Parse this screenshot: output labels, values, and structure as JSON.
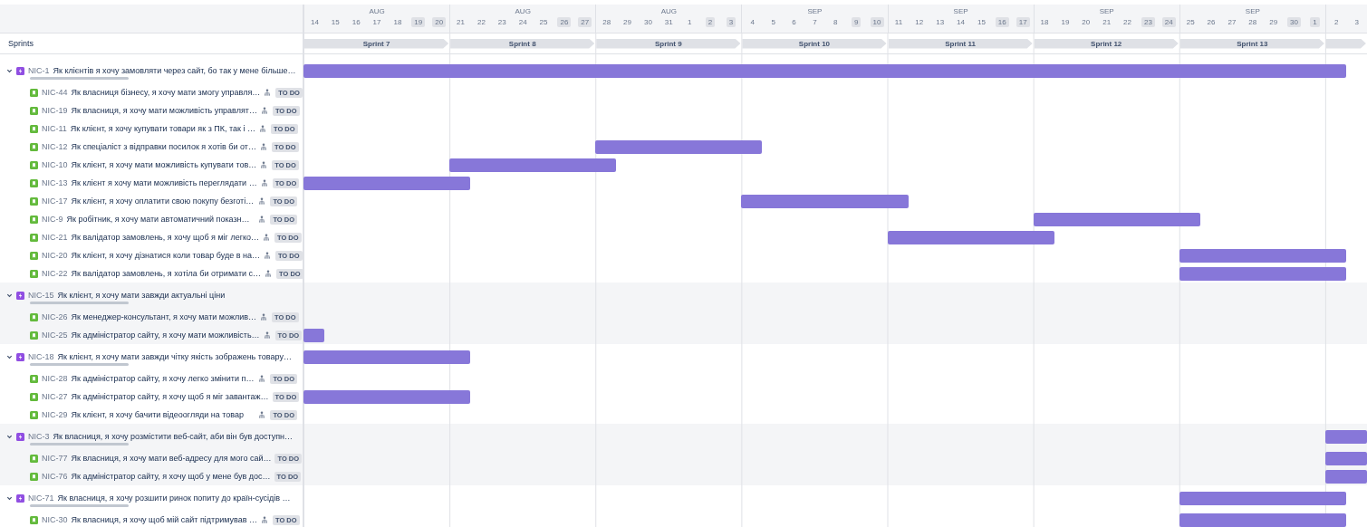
{
  "header": {
    "sprints_label": "Sprints"
  },
  "weeks": [
    {
      "month": "AUG",
      "days": [
        {
          "label": "14",
          "weekend": false
        },
        {
          "label": "15",
          "weekend": false
        },
        {
          "label": "16",
          "weekend": false
        },
        {
          "label": "17",
          "weekend": false
        },
        {
          "label": "18",
          "weekend": false
        },
        {
          "label": "19",
          "weekend": true
        },
        {
          "label": "20",
          "weekend": true
        }
      ]
    },
    {
      "month": "AUG",
      "days": [
        {
          "label": "21",
          "weekend": false
        },
        {
          "label": "22",
          "weekend": false
        },
        {
          "label": "23",
          "weekend": false
        },
        {
          "label": "24",
          "weekend": false
        },
        {
          "label": "25",
          "weekend": false
        },
        {
          "label": "26",
          "weekend": true
        },
        {
          "label": "27",
          "weekend": true
        }
      ]
    },
    {
      "month": "AUG",
      "days": [
        {
          "label": "28",
          "weekend": false
        },
        {
          "label": "29",
          "weekend": false
        },
        {
          "label": "30",
          "weekend": false
        },
        {
          "label": "31",
          "weekend": false
        },
        {
          "label": "1",
          "weekend": false
        },
        {
          "label": "2",
          "weekend": true
        },
        {
          "label": "3",
          "weekend": true
        }
      ]
    },
    {
      "month": "SEP",
      "days": [
        {
          "label": "4",
          "weekend": false
        },
        {
          "label": "5",
          "weekend": false
        },
        {
          "label": "6",
          "weekend": false
        },
        {
          "label": "7",
          "weekend": false
        },
        {
          "label": "8",
          "weekend": false
        },
        {
          "label": "9",
          "weekend": true
        },
        {
          "label": "10",
          "weekend": true
        }
      ]
    },
    {
      "month": "SEP",
      "days": [
        {
          "label": "11",
          "weekend": false
        },
        {
          "label": "12",
          "weekend": false
        },
        {
          "label": "13",
          "weekend": false
        },
        {
          "label": "14",
          "weekend": false
        },
        {
          "label": "15",
          "weekend": false
        },
        {
          "label": "16",
          "weekend": true
        },
        {
          "label": "17",
          "weekend": true
        }
      ]
    },
    {
      "month": "SEP",
      "days": [
        {
          "label": "18",
          "weekend": false
        },
        {
          "label": "19",
          "weekend": false
        },
        {
          "label": "20",
          "weekend": false
        },
        {
          "label": "21",
          "weekend": false
        },
        {
          "label": "22",
          "weekend": false
        },
        {
          "label": "23",
          "weekend": true
        },
        {
          "label": "24",
          "weekend": true
        }
      ]
    },
    {
      "month": "SEP",
      "days": [
        {
          "label": "25",
          "weekend": false
        },
        {
          "label": "26",
          "weekend": false
        },
        {
          "label": "27",
          "weekend": false
        },
        {
          "label": "28",
          "weekend": false
        },
        {
          "label": "29",
          "weekend": false
        },
        {
          "label": "30",
          "weekend": true
        },
        {
          "label": "1",
          "weekend": true
        }
      ]
    },
    {
      "days": [
        {
          "label": "2",
          "weekend": false
        },
        {
          "label": "3",
          "weekend": false
        }
      ]
    }
  ],
  "sprints": [
    {
      "label": "Sprint 7"
    },
    {
      "label": "Sprint 8"
    },
    {
      "label": "Sprint 9"
    },
    {
      "label": "Sprint 10"
    },
    {
      "label": "Sprint 11"
    },
    {
      "label": "Sprint 12"
    },
    {
      "label": "Sprint 13"
    }
  ],
  "epics": [
    {
      "key": "NIC-1",
      "summary": "Як клієнтів я хочу замовляти через сайт, бо так у мене більше…",
      "expanded": true,
      "children": [
        {
          "key": "NIC-44",
          "summary": "Як власниця бізнесу, я хочу мати змогу управля…",
          "assignee_icon": true,
          "status": "TO DO"
        },
        {
          "key": "NIC-19",
          "summary": "Як власниця, я хочу мати можливість управлят…",
          "assignee_icon": true,
          "status": "TO DO"
        },
        {
          "key": "NIC-11",
          "summary": "Як клієнт, я хочу купувати товари як з ПК, так і …",
          "assignee_icon": true,
          "status": "TO DO"
        },
        {
          "key": "NIC-12",
          "summary": "Як спеціаліст з відправки посилок я хотів би от…",
          "assignee_icon": true,
          "status": "TO DO"
        },
        {
          "key": "NIC-10",
          "summary": "Як клієнт, я хочу мати можливість купувати тов…",
          "assignee_icon": true,
          "status": "TO DO"
        },
        {
          "key": "NIC-13",
          "summary": "Як клієнт я хочу мати можливість переглядати …",
          "assignee_icon": true,
          "status": "TO DO"
        },
        {
          "key": "NIC-17",
          "summary": "Як клієнт, я хочу оплатити свою покупу безготі…",
          "assignee_icon": true,
          "status": "TO DO"
        },
        {
          "key": "NIC-9",
          "summary": "Як робітник, я хочу мати автоматичний показн…",
          "assignee_icon": true,
          "status": "TO DO"
        },
        {
          "key": "NIC-21",
          "summary": "Як валідатор замовлень, я хочу щоб я міг легко…",
          "assignee_icon": true,
          "status": "TO DO"
        },
        {
          "key": "NIC-20",
          "summary": "Як клієнт, я хочу дізнатися коли товар буде в на…",
          "assignee_icon": true,
          "status": "TO DO"
        },
        {
          "key": "NIC-22",
          "summary": "Як валідатор замовлень, я хотіла би отримати с…",
          "assignee_icon": true,
          "status": "TO DO"
        }
      ]
    },
    {
      "key": "NIC-15",
      "summary": "Як клієнт, я хочу мати завжди актуальні ціни",
      "expanded": true,
      "children": [
        {
          "key": "NIC-26",
          "summary": "Як менеджер-консультант, я хочу мати можлив…",
          "assignee_icon": true,
          "status": "TO DO"
        },
        {
          "key": "NIC-25",
          "summary": "Як адміністратор сайту, я хочу мати можливість…",
          "assignee_icon": true,
          "status": "TO DO"
        }
      ]
    },
    {
      "key": "NIC-18",
      "summary": "Як клієнт, я хочу мати завжди чітку якість зображень товару…",
      "expanded": true,
      "children": [
        {
          "key": "NIC-28",
          "summary": "Як адміністратор сайту, я хочу легко змінити п…",
          "assignee_icon": true,
          "status": "TO DO"
        },
        {
          "key": "NIC-27",
          "summary": "Як адміністратор сайту, я хочу щоб я міг завантаж…",
          "assignee_icon": false,
          "status": "TO DO"
        },
        {
          "key": "NIC-29",
          "summary": "Як клієнт, я хочу бачити відеоогляди на товар",
          "assignee_icon": true,
          "status": "TO DO"
        }
      ]
    },
    {
      "key": "NIC-3",
      "summary": "Як власниця, я хочу розмістити веб-сайт, аби він був доступн…",
      "expanded": true,
      "children": [
        {
          "key": "NIC-77",
          "summary": "Як власниця, я хочу мати веб-адресу для мого сай…",
          "assignee_icon": false,
          "status": "TO DO"
        },
        {
          "key": "NIC-76",
          "summary": "Як адміністратор сайту, я хочу щоб у мене був дос…",
          "assignee_icon": false,
          "status": "TO DO"
        }
      ]
    },
    {
      "key": "NIC-71",
      "summary": "Як власниця, я хочу розшити ринок попиту до країн-сусідів …",
      "expanded": true,
      "children": [
        {
          "key": "NIC-30",
          "summary": "Як власниця, я хочу щоб мій сайт підтримував …",
          "assignee_icon": true,
          "status": "TO DO"
        }
      ]
    }
  ]
}
